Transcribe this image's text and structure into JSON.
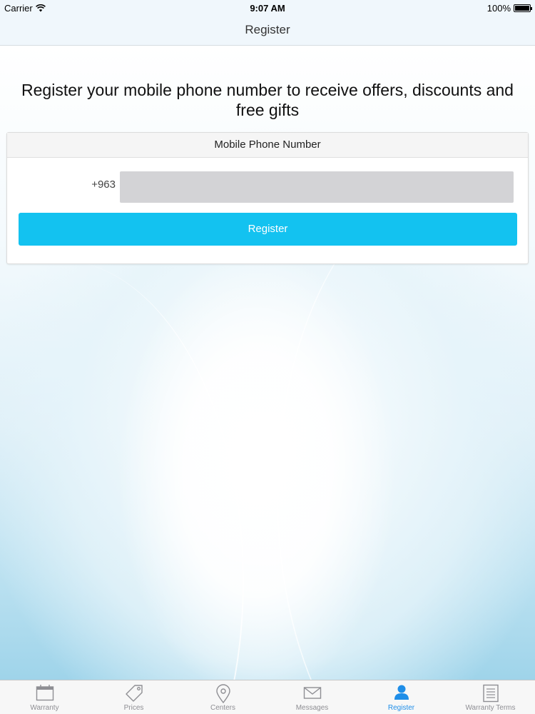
{
  "status_bar": {
    "carrier": "Carrier",
    "time": "9:07 AM",
    "battery": "100%"
  },
  "nav": {
    "title": "Register"
  },
  "main": {
    "heading": "Register your mobile phone number to receive offers, discounts and free gifts",
    "card": {
      "header": "Mobile Phone Number",
      "country_code": "+963",
      "phone_value": "",
      "register_label": "Register"
    }
  },
  "tabbar": {
    "active_color": "#1f8ee8",
    "inactive_color": "#8e8e93",
    "tabs": [
      {
        "label": "Warranty",
        "icon": "calendar-icon"
      },
      {
        "label": "Prices",
        "icon": "price-tag-icon"
      },
      {
        "label": "Centers",
        "icon": "map-pin-icon"
      },
      {
        "label": "Messages",
        "icon": "envelope-icon"
      },
      {
        "label": "Register",
        "icon": "person-icon",
        "active": true
      },
      {
        "label": "Warranty Terms",
        "icon": "document-icon"
      }
    ]
  },
  "colors": {
    "accent": "#13c2f0",
    "input_bg": "#d3d3d6"
  }
}
